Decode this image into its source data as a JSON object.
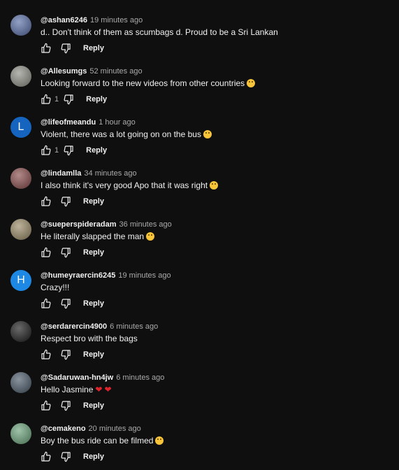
{
  "comments": [
    {
      "handle": "@ashan6246",
      "time": "19 minutes ago",
      "text": "d.. Don't think of them as scumbags d. Proud to be a Sri Lankan",
      "likes": "",
      "reply_label": "Reply",
      "avatar": {
        "type": "image",
        "color": "#5a6ea8"
      },
      "emoji": ""
    },
    {
      "handle": "@Allesumgs",
      "time": "52 minutes ago",
      "text": "Looking forward to the new videos from other countries",
      "likes": "1",
      "reply_label": "Reply",
      "avatar": {
        "type": "image",
        "color": "#8f8f86"
      },
      "emoji": "smile"
    },
    {
      "handle": "@lifeofmeandu",
      "time": "1 hour ago",
      "text": "Violent, there was a lot going on on the bus",
      "likes": "1",
      "reply_label": "Reply",
      "avatar": {
        "type": "letter",
        "letter": "L",
        "color": "#1565c0"
      },
      "emoji": "grin"
    },
    {
      "handle": "@lindamlla",
      "time": "34 minutes ago",
      "text": "I also think it's very good Apo that it was right",
      "likes": "",
      "reply_label": "Reply",
      "avatar": {
        "type": "image",
        "color": "#8a4b4b"
      },
      "emoji": "smile"
    },
    {
      "handle": "@sueperspideradam",
      "time": "36 minutes ago",
      "text": "He literally slapped the man",
      "likes": "",
      "reply_label": "Reply",
      "avatar": {
        "type": "image",
        "color": "#9a8a66"
      },
      "emoji": "surprised"
    },
    {
      "handle": "@humeyraercin6245",
      "time": "19 minutes ago",
      "text": "Crazy!!!",
      "likes": "",
      "reply_label": "Reply",
      "avatar": {
        "type": "letter",
        "letter": "H",
        "color": "#1e88e5"
      },
      "emoji": ""
    },
    {
      "handle": "@serdarercin4900",
      "time": "6 minutes ago",
      "text": "Respect bro with the bags",
      "likes": "",
      "reply_label": "Reply",
      "avatar": {
        "type": "image",
        "color": "#1a1a1a"
      },
      "emoji": ""
    },
    {
      "handle": "@Sadaruwan-hn4jw",
      "time": "6 minutes ago",
      "text": "Hello Jasmine",
      "likes": "",
      "reply_label": "Reply",
      "avatar": {
        "type": "image",
        "color": "#4a5a6a"
      },
      "emoji": "hearts"
    },
    {
      "handle": "@cemakeno",
      "time": "20 minutes ago",
      "text": "Boy the bus ride can be filmed",
      "likes": "",
      "reply_label": "Reply",
      "avatar": {
        "type": "image",
        "color": "#6aa37a"
      },
      "emoji": "grin"
    }
  ]
}
